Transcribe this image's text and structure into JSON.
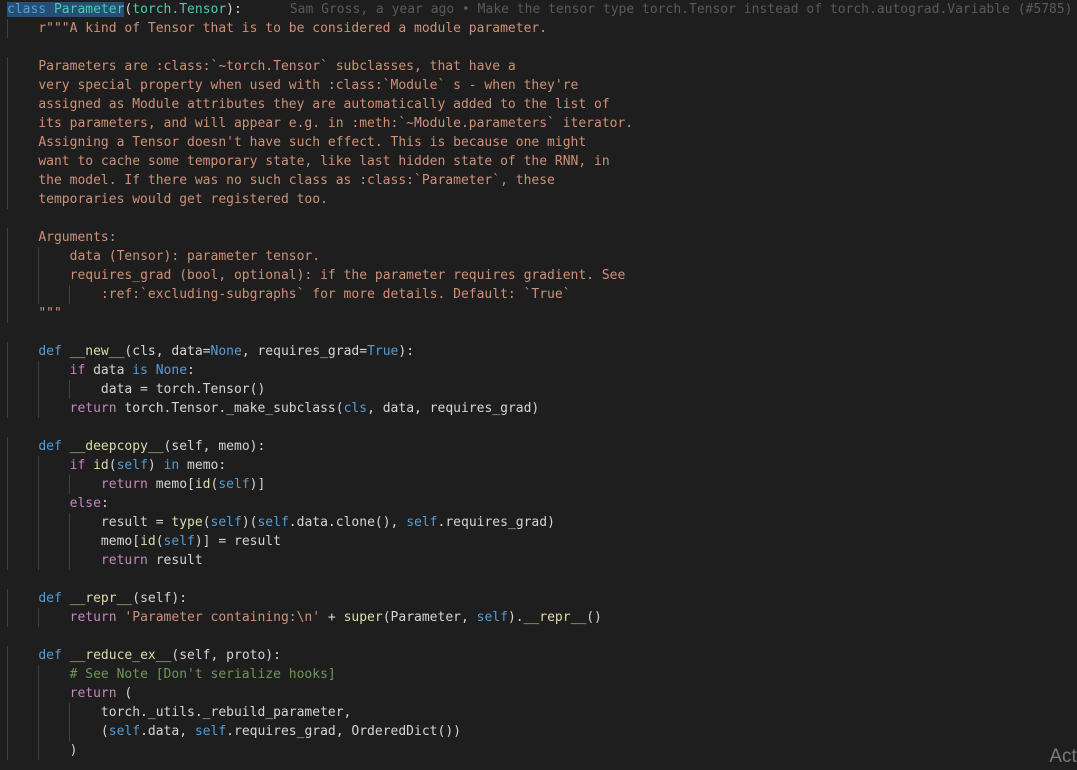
{
  "editor": {
    "language": "python",
    "theme_colors": {
      "background": "#1e1e1e",
      "keyword": "#569cd6",
      "control": "#c586c0",
      "function": "#dcdcaa",
      "class": "#4ec9b0",
      "string": "#ce9178",
      "comment": "#6a9955",
      "text": "#d4d4d4",
      "blame": "#5a5a5a",
      "selection": "#264f78"
    },
    "blame_annotation": "Sam Gross, a year ago • Make the tensor type torch.Tensor instead of torch.autograd.Variable (#5785)",
    "lines": [
      {
        "indent": 0,
        "tokens": [
          {
            "t": "class ",
            "c": "keyword",
            "sel": true
          },
          {
            "t": "Parameter",
            "c": "cls",
            "sel": true
          },
          {
            "t": "(",
            "c": "plain"
          },
          {
            "t": "torch.Tensor",
            "c": "cls"
          },
          {
            "t": "):",
            "c": "plain"
          }
        ],
        "blame": true
      },
      {
        "indent": 1,
        "tokens": [
          {
            "t": "r\"\"\"A kind of Tensor that is to be considered a module parameter.",
            "c": "str"
          }
        ]
      },
      {
        "indent": 0,
        "tokens": []
      },
      {
        "indent": 1,
        "tokens": [
          {
            "t": "Parameters are :class:`~torch.Tensor` subclasses, that have a",
            "c": "str"
          }
        ]
      },
      {
        "indent": 1,
        "tokens": [
          {
            "t": "very special property when used with :class:`Module` s - when they're",
            "c": "str"
          }
        ]
      },
      {
        "indent": 1,
        "tokens": [
          {
            "t": "assigned as Module attributes they are automatically added to the list of",
            "c": "str"
          }
        ]
      },
      {
        "indent": 1,
        "tokens": [
          {
            "t": "its parameters, and will appear e.g. in :meth:`~Module.parameters` iterator.",
            "c": "str"
          }
        ]
      },
      {
        "indent": 1,
        "tokens": [
          {
            "t": "Assigning a Tensor doesn't have such effect. This is because one might",
            "c": "str"
          }
        ]
      },
      {
        "indent": 1,
        "tokens": [
          {
            "t": "want to cache some temporary state, like last hidden state of the RNN, in",
            "c": "str"
          }
        ]
      },
      {
        "indent": 1,
        "tokens": [
          {
            "t": "the model. If there was no such class as :class:`Parameter`, these",
            "c": "str"
          }
        ]
      },
      {
        "indent": 1,
        "tokens": [
          {
            "t": "temporaries would get registered too.",
            "c": "str"
          }
        ]
      },
      {
        "indent": 0,
        "tokens": []
      },
      {
        "indent": 1,
        "tokens": [
          {
            "t": "Arguments:",
            "c": "str"
          }
        ]
      },
      {
        "indent": 2,
        "tokens": [
          {
            "t": "data (Tensor): parameter tensor.",
            "c": "str"
          }
        ]
      },
      {
        "indent": 2,
        "tokens": [
          {
            "t": "requires_grad (bool, optional): if the parameter requires gradient. See",
            "c": "str"
          }
        ]
      },
      {
        "indent": 3,
        "tokens": [
          {
            "t": ":ref:`excluding-subgraphs` for more details. Default: `True`",
            "c": "str"
          }
        ]
      },
      {
        "indent": 1,
        "tokens": [
          {
            "t": "\"\"\"",
            "c": "str"
          }
        ]
      },
      {
        "indent": 0,
        "tokens": []
      },
      {
        "indent": 1,
        "tokens": [
          {
            "t": "def ",
            "c": "keyword"
          },
          {
            "t": "__new__",
            "c": "func"
          },
          {
            "t": "(cls, data=",
            "c": "plain"
          },
          {
            "t": "None",
            "c": "keyword"
          },
          {
            "t": ", requires_grad=",
            "c": "plain"
          },
          {
            "t": "True",
            "c": "keyword"
          },
          {
            "t": "):",
            "c": "plain"
          }
        ]
      },
      {
        "indent": 2,
        "tokens": [
          {
            "t": "if ",
            "c": "control"
          },
          {
            "t": "data ",
            "c": "plain"
          },
          {
            "t": "is ",
            "c": "keyword"
          },
          {
            "t": "None",
            "c": "keyword"
          },
          {
            "t": ":",
            "c": "plain"
          }
        ]
      },
      {
        "indent": 3,
        "tokens": [
          {
            "t": "data = torch.Tensor()",
            "c": "plain"
          }
        ]
      },
      {
        "indent": 2,
        "tokens": [
          {
            "t": "return ",
            "c": "control"
          },
          {
            "t": "torch.Tensor._make_subclass(",
            "c": "plain"
          },
          {
            "t": "cls",
            "c": "keyword"
          },
          {
            "t": ", data, requires_grad)",
            "c": "plain"
          }
        ]
      },
      {
        "indent": 0,
        "tokens": []
      },
      {
        "indent": 1,
        "tokens": [
          {
            "t": "def ",
            "c": "keyword"
          },
          {
            "t": "__deepcopy__",
            "c": "func"
          },
          {
            "t": "(self, memo):",
            "c": "plain"
          }
        ]
      },
      {
        "indent": 2,
        "tokens": [
          {
            "t": "if ",
            "c": "control"
          },
          {
            "t": "id",
            "c": "func"
          },
          {
            "t": "(",
            "c": "plain"
          },
          {
            "t": "self",
            "c": "self"
          },
          {
            "t": ") ",
            "c": "plain"
          },
          {
            "t": "in ",
            "c": "keyword"
          },
          {
            "t": "memo:",
            "c": "plain"
          }
        ]
      },
      {
        "indent": 3,
        "tokens": [
          {
            "t": "return ",
            "c": "control"
          },
          {
            "t": "memo[",
            "c": "plain"
          },
          {
            "t": "id",
            "c": "func"
          },
          {
            "t": "(",
            "c": "plain"
          },
          {
            "t": "self",
            "c": "self"
          },
          {
            "t": ")]",
            "c": "plain"
          }
        ]
      },
      {
        "indent": 2,
        "tokens": [
          {
            "t": "else",
            "c": "control"
          },
          {
            "t": ":",
            "c": "plain"
          }
        ]
      },
      {
        "indent": 3,
        "tokens": [
          {
            "t": "result = ",
            "c": "plain"
          },
          {
            "t": "type",
            "c": "func"
          },
          {
            "t": "(",
            "c": "plain"
          },
          {
            "t": "self",
            "c": "self"
          },
          {
            "t": ")(",
            "c": "plain"
          },
          {
            "t": "self",
            "c": "self"
          },
          {
            "t": ".data.clone(), ",
            "c": "plain"
          },
          {
            "t": "self",
            "c": "self"
          },
          {
            "t": ".requires_grad)",
            "c": "plain"
          }
        ]
      },
      {
        "indent": 3,
        "tokens": [
          {
            "t": "memo[",
            "c": "plain"
          },
          {
            "t": "id",
            "c": "func"
          },
          {
            "t": "(",
            "c": "plain"
          },
          {
            "t": "self",
            "c": "self"
          },
          {
            "t": ")] = result",
            "c": "plain"
          }
        ]
      },
      {
        "indent": 3,
        "tokens": [
          {
            "t": "return ",
            "c": "control"
          },
          {
            "t": "result",
            "c": "plain"
          }
        ]
      },
      {
        "indent": 0,
        "tokens": []
      },
      {
        "indent": 1,
        "tokens": [
          {
            "t": "def ",
            "c": "keyword"
          },
          {
            "t": "__repr__",
            "c": "func"
          },
          {
            "t": "(self):",
            "c": "plain"
          }
        ]
      },
      {
        "indent": 2,
        "tokens": [
          {
            "t": "return ",
            "c": "control"
          },
          {
            "t": "'Parameter containing:\\n' ",
            "c": "str"
          },
          {
            "t": "+ ",
            "c": "plain"
          },
          {
            "t": "super",
            "c": "func"
          },
          {
            "t": "(Parameter, ",
            "c": "plain"
          },
          {
            "t": "self",
            "c": "self"
          },
          {
            "t": ").",
            "c": "plain"
          },
          {
            "t": "__repr__",
            "c": "func"
          },
          {
            "t": "()",
            "c": "plain"
          }
        ]
      },
      {
        "indent": 0,
        "tokens": []
      },
      {
        "indent": 1,
        "tokens": [
          {
            "t": "def ",
            "c": "keyword"
          },
          {
            "t": "__reduce_ex__",
            "c": "func"
          },
          {
            "t": "(self, proto):",
            "c": "plain"
          }
        ]
      },
      {
        "indent": 2,
        "tokens": [
          {
            "t": "# See Note [Don't serialize hooks]",
            "c": "comment"
          }
        ]
      },
      {
        "indent": 2,
        "tokens": [
          {
            "t": "return ",
            "c": "control"
          },
          {
            "t": "(",
            "c": "plain"
          }
        ]
      },
      {
        "indent": 3,
        "tokens": [
          {
            "t": "torch._utils._rebuild_parameter,",
            "c": "plain"
          }
        ]
      },
      {
        "indent": 3,
        "tokens": [
          {
            "t": "(",
            "c": "plain"
          },
          {
            "t": "self",
            "c": "self"
          },
          {
            "t": ".data, ",
            "c": "plain"
          },
          {
            "t": "self",
            "c": "self"
          },
          {
            "t": ".requires_grad, OrderedDict())",
            "c": "plain"
          }
        ]
      },
      {
        "indent": 2,
        "tokens": [
          {
            "t": ")",
            "c": "plain"
          }
        ]
      }
    ]
  },
  "watermark": {
    "text": "Acti"
  }
}
